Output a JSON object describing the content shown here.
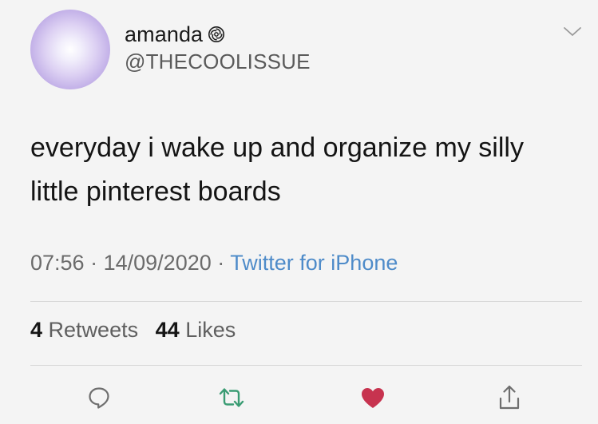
{
  "author": {
    "display_name": "amanda",
    "handle": "@THECOOLISSUE",
    "badge_icon": "verified-swirl-icon"
  },
  "tweet": {
    "text": "everyday i wake up and organize my silly little pinterest boards"
  },
  "meta": {
    "time": "07:56",
    "separator": "·",
    "date": "14/09/2020",
    "source": "Twitter for iPhone"
  },
  "stats": {
    "retweets_count": "4",
    "retweets_label": "Retweets",
    "likes_count": "44",
    "likes_label": "Likes"
  },
  "actions": {
    "reply_icon": "reply-bubble-icon",
    "retweet_icon": "retweet-icon",
    "like_icon": "heart-icon",
    "share_icon": "share-icon"
  },
  "colors": {
    "background": "#f4f4f4",
    "link_blue": "#4e8bc9",
    "retweet_green": "#3a9c73",
    "like_red": "#c7334f",
    "icon_gray": "#6e6e6e"
  }
}
